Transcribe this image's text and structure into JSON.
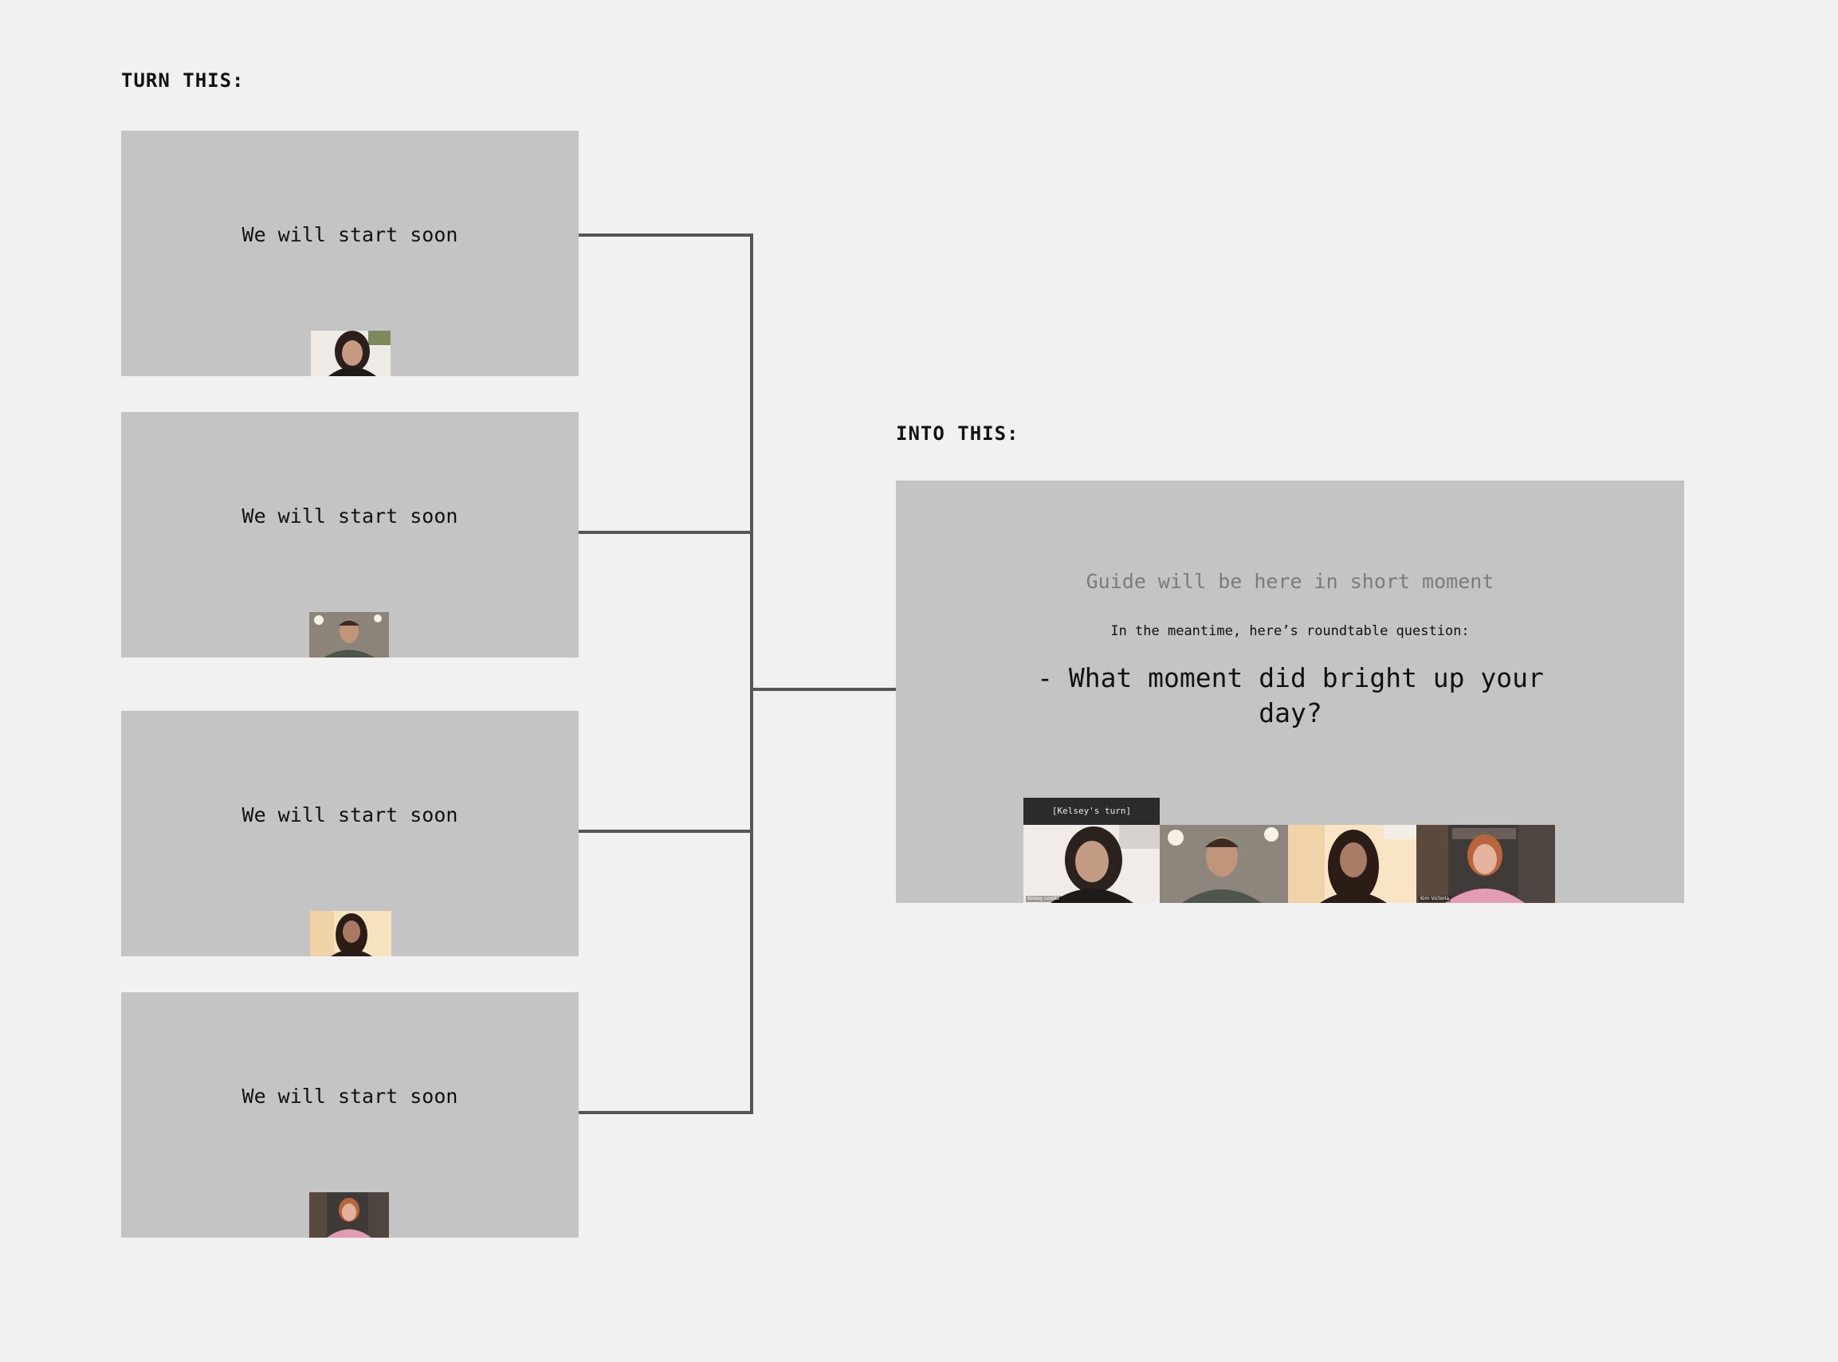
{
  "left_heading": "TURN THIS:",
  "right_heading": "INTO THIS:",
  "small_slides": [
    {
      "text": "We will start soon",
      "thumb_icon": "participant-video-woman-dark-hair"
    },
    {
      "text": "We will start soon",
      "thumb_icon": "participant-video-man"
    },
    {
      "text": "We will start soon",
      "thumb_icon": "participant-video-woman-long-hair"
    },
    {
      "text": "We will start soon",
      "thumb_icon": "participant-video-woman-red-hair"
    }
  ],
  "big_slide": {
    "guide_text": "Guide will be here in short moment",
    "meantime_text": "In the meantime, here’s roundtable question:",
    "question": "- What moment did bright up your day?",
    "turn_badge": "[Kelsey's turn]",
    "participants": [
      {
        "name_tag": "Kelsey Lowitz",
        "icon": "participant-video-woman-dark-hair"
      },
      {
        "name_tag": "",
        "icon": "participant-video-man"
      },
      {
        "name_tag": "",
        "icon": "participant-video-woman-long-hair"
      },
      {
        "name_tag": "Kim Victoria",
        "icon": "participant-video-woman-red-hair"
      }
    ]
  },
  "colors": {
    "page_background": "#f1f1f1",
    "slide_background": "#c4c4c4",
    "connector": "#555555",
    "guide_text": "#7b7b7b",
    "badge_background": "#2b2b2b"
  }
}
